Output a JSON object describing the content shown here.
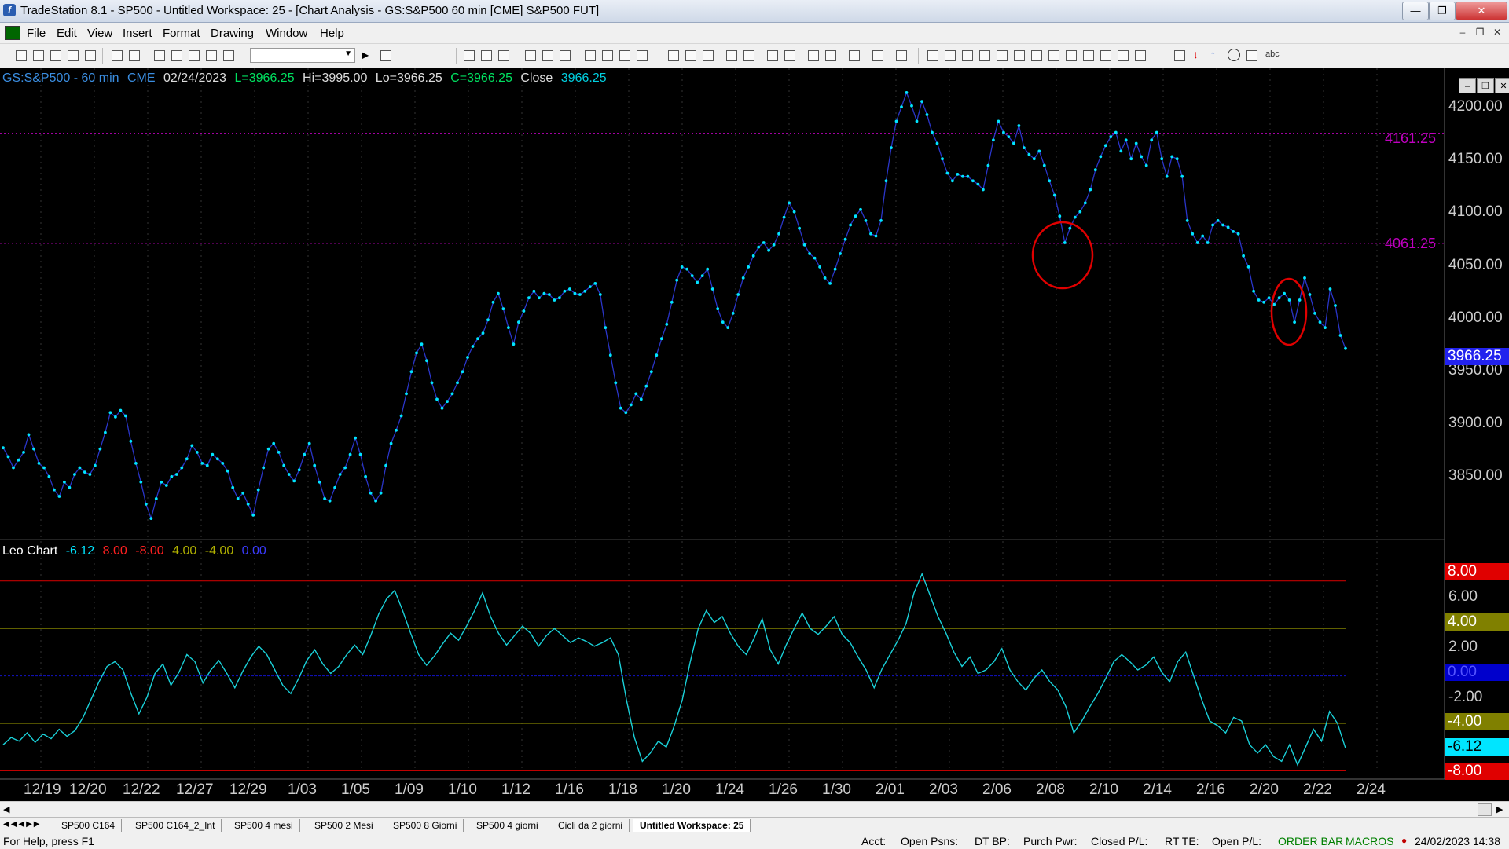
{
  "window": {
    "title": "TradeStation 8.1 - SP500 - Untitled Workspace:  25 - [Chart Analysis - GS:S&P500  60 min  [CME] S&P500 FUT]",
    "app_icon": "tradestation-logo-icon"
  },
  "menu": [
    "File",
    "Edit",
    "View",
    "Insert",
    "Format",
    "Drawing",
    "Window",
    "Help"
  ],
  "chart_info": {
    "symbol": "GS:S&P500 - 60 min",
    "exchange": "CME",
    "date": "02/24/2023",
    "last": "L=3966.25",
    "high": "Hi=3995.00",
    "low": "Lo=3966.25",
    "close_c": "C=3966.25",
    "close_label": "Close",
    "close_value": "3966.25"
  },
  "indicator_info": {
    "name": "Leo Chart",
    "v1": "-6.12",
    "v2": "8.00",
    "v3": "-8.00",
    "v4": "4.00",
    "v5": "-4.00",
    "v6": "0.00"
  },
  "price_axis": [
    "4200.00",
    "4150.00",
    "4100.00",
    "4050.00",
    "4000.00",
    "3950.00",
    "3900.00",
    "3850.00"
  ],
  "price_last": "3966.25",
  "hlines": [
    "4161.25",
    "4061.25"
  ],
  "indicator_axis": {
    "plain": [
      "6.00",
      "2.00",
      "-2.00"
    ],
    "boxes": [
      {
        "text": "8.00",
        "bg": "#e00000",
        "fg": "#ffffff"
      },
      {
        "text": "4.00",
        "bg": "#808000",
        "fg": "#ffffff"
      },
      {
        "text": "0.00",
        "bg": "#0000cc",
        "fg": "#5555ff"
      },
      {
        "text": "-4.00",
        "bg": "#808000",
        "fg": "#ffffff"
      },
      {
        "text": "-6.12",
        "bg": "#00e5ff",
        "fg": "#000000"
      },
      {
        "text": "-8.00",
        "bg": "#e00000",
        "fg": "#ffffff"
      }
    ]
  },
  "date_axis": [
    "12/19",
    "12/20",
    "12/22",
    "12/27",
    "12/29",
    "1/03",
    "1/05",
    "1/09",
    "1/10",
    "1/12",
    "1/16",
    "1/18",
    "1/20",
    "1/24",
    "1/26",
    "1/30",
    "2/01",
    "2/03",
    "2/06",
    "2/08",
    "2/10",
    "2/14",
    "2/16",
    "2/20",
    "2/22",
    "2/24"
  ],
  "tabs": [
    "SP500 C164",
    "SP500 C164_2_Int",
    "SP500 4 mesi",
    "SP500  2 Mesi",
    "SP500 8 Giorni",
    "SP500 4 giorni",
    "Cicli da 2 giorni",
    "Untitled Workspace: 25"
  ],
  "status": {
    "help": "For Help, press F1",
    "acct": "Acct:",
    "open_psns": "Open Psns:",
    "dt_bp": "DT BP:",
    "purch_pwr": "Purch Pwr:",
    "closed_pl": "Closed P/L:",
    "rt_te": "RT TE:",
    "open_pl": "Open P/L:",
    "order_bar": "ORDER BAR",
    "macros": "MACROS",
    "datetime": "24/02/2023 14:38"
  },
  "colors": {
    "price_line": "#2a35c8",
    "price_dot": "#00e5ff",
    "indicator": "#1ad0d8",
    "grid": "#333333",
    "annotation": "#e00000",
    "hline": "#a000a0"
  },
  "chart_data": {
    "type": "line",
    "x_range": [
      "12/19",
      "2/24"
    ],
    "price": {
      "name": "GS:S&P500 - 60 min",
      "ylim": [
        3800,
        4220
      ],
      "values": [
        3876,
        3868,
        3858,
        3865,
        3872,
        3888,
        3875,
        3862,
        3858,
        3850,
        3838,
        3832,
        3845,
        3840,
        3852,
        3858,
        3854,
        3852,
        3860,
        3875,
        3890,
        3908,
        3904,
        3910,
        3905,
        3882,
        3862,
        3845,
        3825,
        3812,
        3830,
        3845,
        3842,
        3850,
        3852,
        3858,
        3866,
        3878,
        3872,
        3862,
        3860,
        3870,
        3866,
        3862,
        3855,
        3840,
        3830,
        3835,
        3825,
        3815,
        3838,
        3858,
        3875,
        3880,
        3872,
        3860,
        3852,
        3846,
        3856,
        3870,
        3880,
        3860,
        3845,
        3830,
        3828,
        3840,
        3852,
        3858,
        3870,
        3885,
        3870,
        3850,
        3835,
        3828,
        3835,
        3860,
        3880,
        3892,
        3905,
        3925,
        3945,
        3962,
        3970,
        3955,
        3935,
        3920,
        3912,
        3918,
        3925,
        3935,
        3945,
        3958,
        3968,
        3975,
        3980,
        3992,
        4008,
        4016,
        4002,
        3985,
        3970,
        3990,
        4000,
        4012,
        4018,
        4012,
        4016,
        4015,
        4010,
        4012,
        4018,
        4020,
        4016,
        4015,
        4018,
        4022,
        4025,
        4015,
        3985,
        3960,
        3935,
        3912,
        3908,
        3915,
        3925,
        3920,
        3932,
        3945,
        3960,
        3975,
        3988,
        4008,
        4028,
        4040,
        4038,
        4032,
        4026,
        4032,
        4038,
        4020,
        4002,
        3990,
        3985,
        3998,
        4015,
        4030,
        4040,
        4050,
        4058,
        4062,
        4055,
        4060,
        4070,
        4085,
        4098,
        4090,
        4075,
        4060,
        4052,
        4048,
        4040,
        4030,
        4025,
        4038,
        4052,
        4065,
        4078,
        4086,
        4092,
        4082,
        4070,
        4068,
        4082,
        4118,
        4148,
        4172,
        4185,
        4198,
        4186,
        4172,
        4190,
        4178,
        4162,
        4152,
        4138,
        4125,
        4118,
        4124,
        4122,
        4122,
        4118,
        4115,
        4110,
        4132,
        4155,
        4172,
        4162,
        4158,
        4152,
        4168,
        4148,
        4142,
        4138,
        4145,
        4132,
        4118,
        4105,
        4086,
        4062,
        4075,
        4085,
        4090,
        4098,
        4110,
        4128,
        4140,
        4150,
        4158,
        4162,
        4145,
        4155,
        4138,
        4152,
        4140,
        4132,
        4155,
        4162,
        4138,
        4122,
        4140,
        4138,
        4122,
        4082,
        4070,
        4062,
        4068,
        4062,
        4078,
        4082,
        4078,
        4076,
        4072,
        4070,
        4050,
        4040,
        4018,
        4010,
        4008,
        4012,
        4006,
        4012,
        4016,
        4010,
        3990,
        4010,
        4030,
        4015,
        3998,
        3990,
        3985,
        4020,
        4005,
        3978,
        3966
      ]
    },
    "indicator": {
      "name": "Leo Chart",
      "ylim": [
        -8.5,
        9.5
      ],
      "reference_lines": [
        8.0,
        4.0,
        0.0,
        -4.0,
        -8.0
      ],
      "values": [
        -5.8,
        -5.2,
        -5.5,
        -4.8,
        -5.6,
        -4.9,
        -5.3,
        -4.5,
        -5.1,
        -4.6,
        -3.5,
        -2.0,
        -0.5,
        0.8,
        1.2,
        0.5,
        -1.5,
        -3.2,
        -1.8,
        0.2,
        1.0,
        -0.8,
        0.3,
        1.8,
        1.2,
        -0.6,
        0.5,
        1.3,
        0.2,
        -1.0,
        0.4,
        1.6,
        2.5,
        1.8,
        0.5,
        -0.8,
        -1.5,
        -0.2,
        1.3,
        2.2,
        1.0,
        0.2,
        0.8,
        1.8,
        2.6,
        1.8,
        3.4,
        5.2,
        6.5,
        7.2,
        5.5,
        3.6,
        1.8,
        0.9,
        1.7,
        2.7,
        3.6,
        3.0,
        4.2,
        5.5,
        7.0,
        5.0,
        3.6,
        2.6,
        3.4,
        4.2,
        3.6,
        2.5,
        3.4,
        4.0,
        3.4,
        2.8,
        3.2,
        2.9,
        2.5,
        2.8,
        3.2,
        1.8,
        -2.0,
        -5.2,
        -7.2,
        -6.5,
        -5.5,
        -6.0,
        -4.2,
        -2.0,
        1.2,
        4.0,
        5.5,
        4.5,
        5.0,
        3.6,
        2.5,
        1.8,
        3.2,
        4.8,
        2.2,
        1.0,
        2.6,
        4.0,
        5.3,
        4.0,
        3.5,
        4.2,
        5.0,
        3.5,
        2.8,
        1.6,
        0.5,
        -1.0,
        0.6,
        1.8,
        3.0,
        4.4,
        7.0,
        8.6,
        6.8,
        5.0,
        3.6,
        2.0,
        0.8,
        1.6,
        0.2,
        0.5,
        1.2,
        2.3,
        0.5,
        -0.5,
        -1.2,
        -0.2,
        0.5,
        -0.5,
        -1.2,
        -2.6,
        -4.8,
        -3.8,
        -2.6,
        -1.5,
        -0.2,
        1.2,
        1.8,
        1.2,
        0.5,
        0.9,
        1.6,
        0.3,
        -0.5,
        1.2,
        2.0,
        0.0,
        -2.0,
        -3.8,
        -4.2,
        -4.8,
        -3.5,
        -3.8,
        -5.8,
        -6.5,
        -5.8,
        -6.8,
        -7.2,
        -5.8,
        -7.5,
        -6.0,
        -4.5,
        -5.5,
        -3.0,
        -4.0,
        -6.1
      ]
    }
  }
}
